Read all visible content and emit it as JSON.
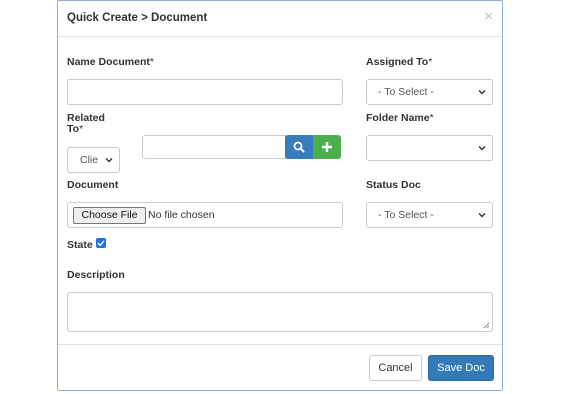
{
  "modal": {
    "title": "Quick Create > Document",
    "close_glyph": "×"
  },
  "form": {
    "name_document": {
      "label": "Name Document",
      "value": ""
    },
    "assigned_to": {
      "label": "Assigned To",
      "selected": "- To Select -"
    },
    "related_to": {
      "label_line1": "Related",
      "label_line2": "To",
      "selected": "Clie",
      "search_value": ""
    },
    "folder_name": {
      "label": "Folder Name",
      "selected": ""
    },
    "document": {
      "label": "Document",
      "choose_button": "Choose File",
      "status": "No file chosen"
    },
    "status_doc": {
      "label": "Status Doc",
      "selected": "- To Select -"
    },
    "state": {
      "label": "State",
      "checked": true
    },
    "description": {
      "label": "Description",
      "value": ""
    }
  },
  "footer": {
    "cancel_label": "Cancel",
    "save_label": "Save Doc"
  },
  "colors": {
    "primary": "#337ab7",
    "success": "#4cae4c",
    "checkbox": "#1a73e8",
    "modal_border": "#8fb3d4"
  },
  "icons": {
    "search": "search-icon",
    "add": "plus-icon",
    "close": "close-icon",
    "dropdown": "chevron-down-icon"
  }
}
